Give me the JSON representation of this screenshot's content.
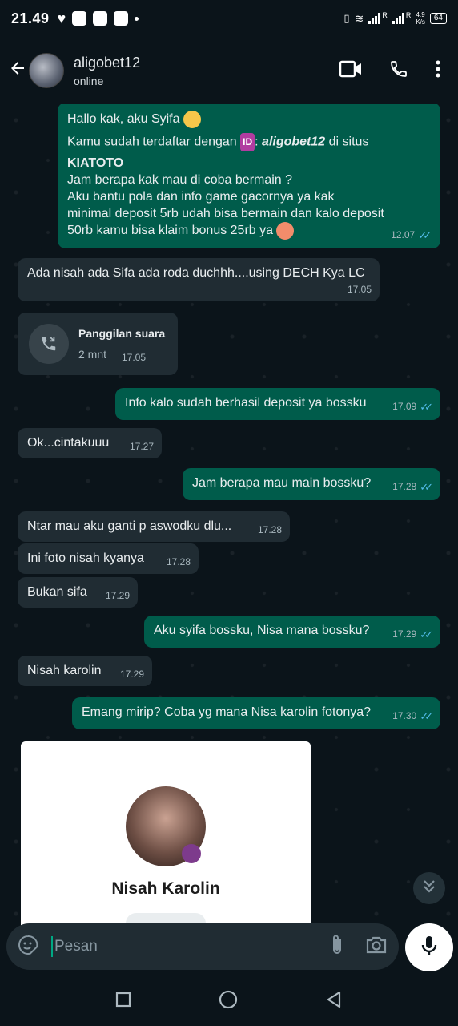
{
  "status_bar": {
    "time": "21.49",
    "network_speed_value": "4.9",
    "network_speed_unit": "K/s",
    "battery": "64",
    "signal_label_1": "R",
    "signal_label_2": "R"
  },
  "header": {
    "contact_name": "aligobet12",
    "contact_status": "online"
  },
  "messages": [
    {
      "dir": "out",
      "lines": [
        "Hallo kak, aku Syifa",
        "Kamu sudah terdaftar dengan",
        "aligobet12",
        "di situs",
        "KIATOTO",
        "Jam berapa kak mau di coba bermain ?",
        "Aku bantu pola dan info game gacornya ya kak",
        "minimal deposit 5rb udah bisa bermain dan kalo deposit",
        "50rb kamu bisa klaim bonus 25rb ya"
      ],
      "time": "12.07",
      "id_badge": "ID"
    },
    {
      "dir": "in",
      "text": "Ada nisah ada Sifa ada roda duchhh....using DECH Kya LC",
      "time": "17.05"
    },
    {
      "dir": "in",
      "type": "call",
      "title": "Panggilan suara",
      "duration": "2 mnt",
      "time": "17.05"
    },
    {
      "dir": "out",
      "text": "Info kalo sudah berhasil deposit ya bossku",
      "time": "17.09"
    },
    {
      "dir": "in",
      "text": "Ok...cintakuuu",
      "time": "17.27"
    },
    {
      "dir": "out",
      "text": "Jam berapa mau main bossku?",
      "time": "17.28"
    },
    {
      "dir": "in",
      "text": "Ntar mau aku ganti p aswodku dlu...",
      "time": "17.28"
    },
    {
      "dir": "in",
      "text": "Ini foto nisah kyanya",
      "time": "17.28"
    },
    {
      "dir": "in",
      "text": "Bukan sifa",
      "time": "17.29"
    },
    {
      "dir": "out",
      "text": "Aku syifa bossku, Nisa mana bossku?",
      "time": "17.29"
    },
    {
      "dir": "in",
      "text": "Nisah karolin",
      "time": "17.29"
    },
    {
      "dir": "out",
      "text": "Emang mirip? Coba yg mana Nisa karolin fotonya?",
      "time": "17.30"
    }
  ],
  "profile_card": {
    "name": "Nisah Karolin"
  },
  "composer": {
    "placeholder": "Pesan"
  },
  "icons": {
    "back": "arrow-left-icon",
    "video": "video-call-icon",
    "call": "phone-icon",
    "menu": "more-vertical-icon",
    "emoji": "sticker-icon",
    "attach": "paperclip-icon",
    "camera": "camera-icon",
    "mic": "microphone-icon"
  },
  "colors": {
    "background": "#0b141a",
    "incoming_bubble": "#202c33",
    "outgoing_bubble": "#005c4b",
    "read_ticks": "#53bdeb",
    "accent": "#00a884"
  }
}
